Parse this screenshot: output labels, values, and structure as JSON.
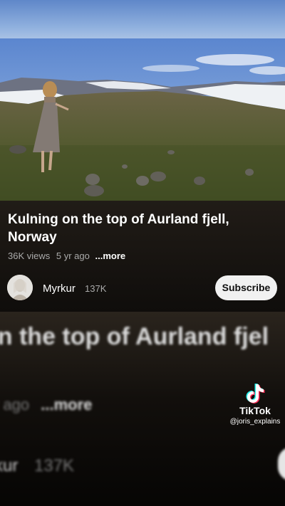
{
  "video": {
    "title": "Kulning on the top of Aurland fjell, Norway",
    "views": "36K views",
    "age": "5 yr ago",
    "more": "...more"
  },
  "channel": {
    "name": "Myrkur",
    "subscribers": "137K",
    "subscribe_label": "Subscribe"
  },
  "zoomed": {
    "title_fragment": "on the top of Aurland fjel",
    "meta_fragment": "yr ago",
    "more": "...more",
    "channel_fragment": "kur",
    "subscribers": "137K"
  },
  "watermark": {
    "brand": "TikTok",
    "handle": "@joris_explains"
  },
  "colors": {
    "subscribe_bg": "#f1f1f1",
    "meta_text": "#aaaaaa",
    "background": "#0b0a08"
  }
}
